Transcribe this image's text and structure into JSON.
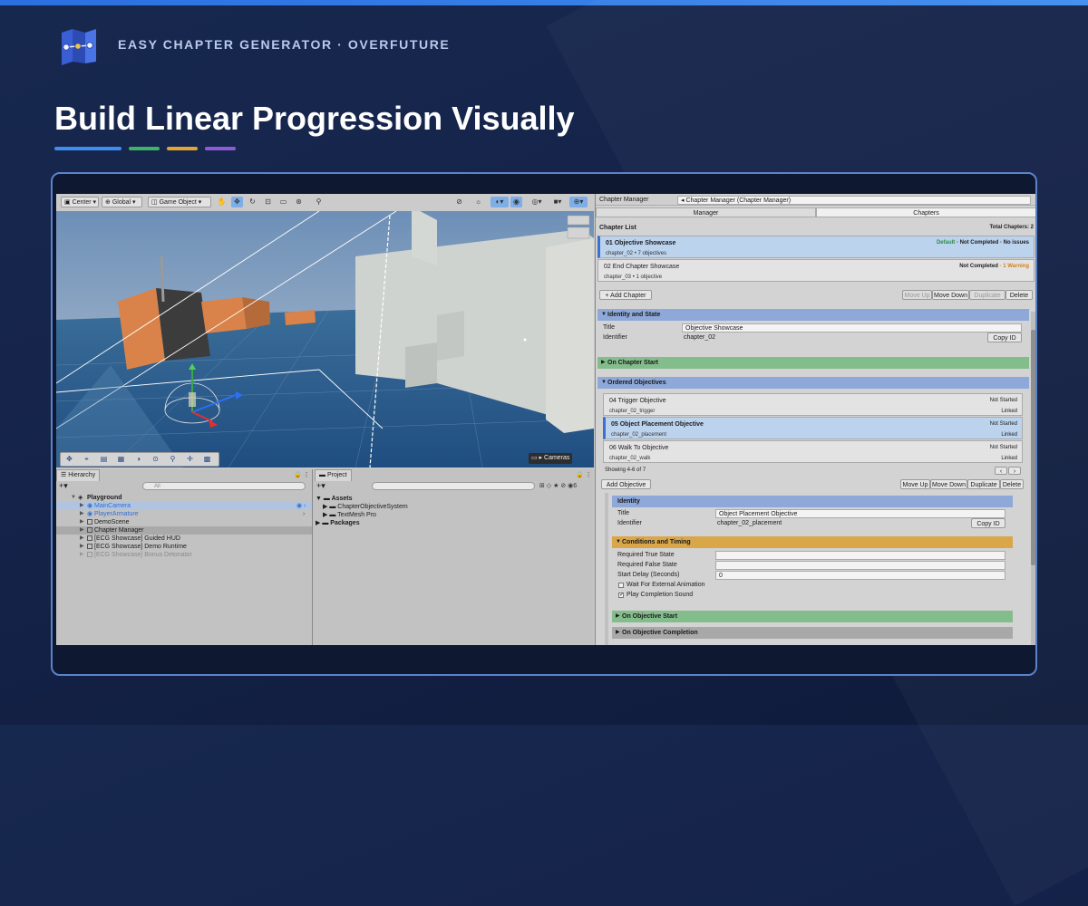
{
  "brand": "EASY CHAPTER GENERATOR · OVERFUTURE",
  "headline": "Build Linear Progression Visually",
  "accent_colors": [
    "#3f8df0",
    "#3fb36b",
    "#e3a531",
    "#8e5bd8"
  ],
  "scene_toolbar": {
    "pivot": "Center",
    "space": "Global",
    "object_mode": "Game Object"
  },
  "scene_overlay": {
    "cameras": "Cameras"
  },
  "hierarchy": {
    "title": "Hierarchy",
    "search_placeholder": "All",
    "items": [
      {
        "label": "Playground",
        "kind": "scene"
      },
      {
        "label": "MainCamera",
        "kind": "prefab"
      },
      {
        "label": "PlayerArmature",
        "kind": "prefab"
      },
      {
        "label": "DemoScene",
        "kind": "object"
      },
      {
        "label": "Chapter Manager",
        "kind": "object"
      },
      {
        "label": "[ECG Showcase] Guided HUD",
        "kind": "object"
      },
      {
        "label": "[ECG Showcase] Demo Runtime",
        "kind": "object"
      },
      {
        "label": "[ECG Showcase] Bonus Detonator",
        "kind": "disabled"
      }
    ]
  },
  "project": {
    "title": "Project",
    "badge": "6",
    "items": [
      {
        "label": "Assets"
      },
      {
        "label": "ChapterObjectiveSystem"
      },
      {
        "label": "TextMesh Pro"
      },
      {
        "label": "Packages"
      }
    ]
  },
  "inspector": {
    "title": "Chapter Manager",
    "object_field": "Chapter Manager (Chapter Manager)",
    "tabs": [
      "Manager",
      "Chapters"
    ],
    "chapter_list_label": "Chapter List",
    "total_chapters": "Total Chapters: 2",
    "chapters": [
      {
        "title": "01  Objective Showcase",
        "sub": "chapter_02  •  7 objectives",
        "status_a": "Default",
        "status_b": " · Not Completed · No issues"
      },
      {
        "title": "02  End Chapter Showcase",
        "sub": "chapter_03  •  1 objective",
        "status_a": "Not Completed",
        "status_b": " · 1 Warning"
      }
    ],
    "add_chapter": "+ Add Chapter",
    "chapter_buttons": [
      "Move Up",
      "Move Down",
      "Duplicate",
      "Delete"
    ],
    "identity_state": "Identity and State",
    "title_label": "Title",
    "title_value": "Objective Showcase",
    "identifier_label": "Identifier",
    "identifier_value": "chapter_02",
    "copy_id": "Copy ID",
    "on_chapter_start": "On Chapter Start",
    "ordered_objectives": "Ordered Objectives",
    "objectives": [
      {
        "title": "04  Trigger Objective",
        "sub": "chapter_02_trigger",
        "state": "Not Started",
        "link": "Linked"
      },
      {
        "title": "05  Object Placement Objective",
        "sub": "chapter_02_placement",
        "state": "Not Started",
        "link": "Linked"
      },
      {
        "title": "06  Walk To Objective",
        "sub": "chapter_02_walk",
        "state": "Not Started",
        "link": "Linked"
      }
    ],
    "showing": "Showing 4-6 of 7",
    "add_objective": "Add Objective",
    "objective_buttons": [
      "Move Up",
      "Move Down",
      "Duplicate",
      "Delete"
    ],
    "obj_identity": "Identity",
    "obj_title_label": "Title",
    "obj_title_value": "Object Placement Objective",
    "obj_identifier_label": "Identifier",
    "obj_identifier_value": "chapter_02_placement",
    "conditions": "Conditions and Timing",
    "required_true": "Required True State",
    "required_false": "Required False State",
    "start_delay": "Start Delay (Seconds)",
    "start_delay_value": "0",
    "wait_external": "Wait For External Animation",
    "play_sound": "Play Completion Sound",
    "on_obj_start": "On Objective Start",
    "on_obj_completion": "On Objective Completion"
  }
}
